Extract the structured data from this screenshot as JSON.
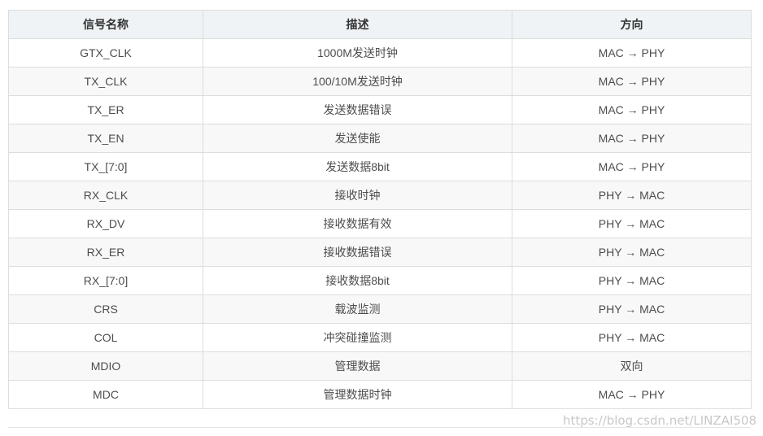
{
  "table": {
    "headers": [
      "信号名称",
      "描述",
      "方向"
    ],
    "rows": [
      [
        "GTX_CLK",
        "1000M发送时钟",
        "MAC → PHY"
      ],
      [
        "TX_CLK",
        "100/10M发送时钟",
        "MAC → PHY"
      ],
      [
        "TX_ER",
        "发送数据错误",
        "MAC → PHY"
      ],
      [
        "TX_EN",
        "发送使能",
        "MAC → PHY"
      ],
      [
        "TX_[7:0]",
        "发送数据8bit",
        "MAC → PHY"
      ],
      [
        "RX_CLK",
        "接收时钟",
        "PHY → MAC"
      ],
      [
        "RX_DV",
        "接收数据有效",
        "PHY → MAC"
      ],
      [
        "RX_ER",
        "接收数据错误",
        "PHY → MAC"
      ],
      [
        "RX_[7:0]",
        "接收数据8bit",
        "PHY → MAC"
      ],
      [
        "CRS",
        "载波监测",
        "PHY → MAC"
      ],
      [
        "COL",
        "冲突碰撞监测",
        "PHY → MAC"
      ],
      [
        "MDIO",
        "管理数据",
        "双向"
      ],
      [
        "MDC",
        "管理数据时钟",
        "MAC → PHY"
      ]
    ]
  },
  "watermark": "https://blog.csdn.net/LINZAI508"
}
